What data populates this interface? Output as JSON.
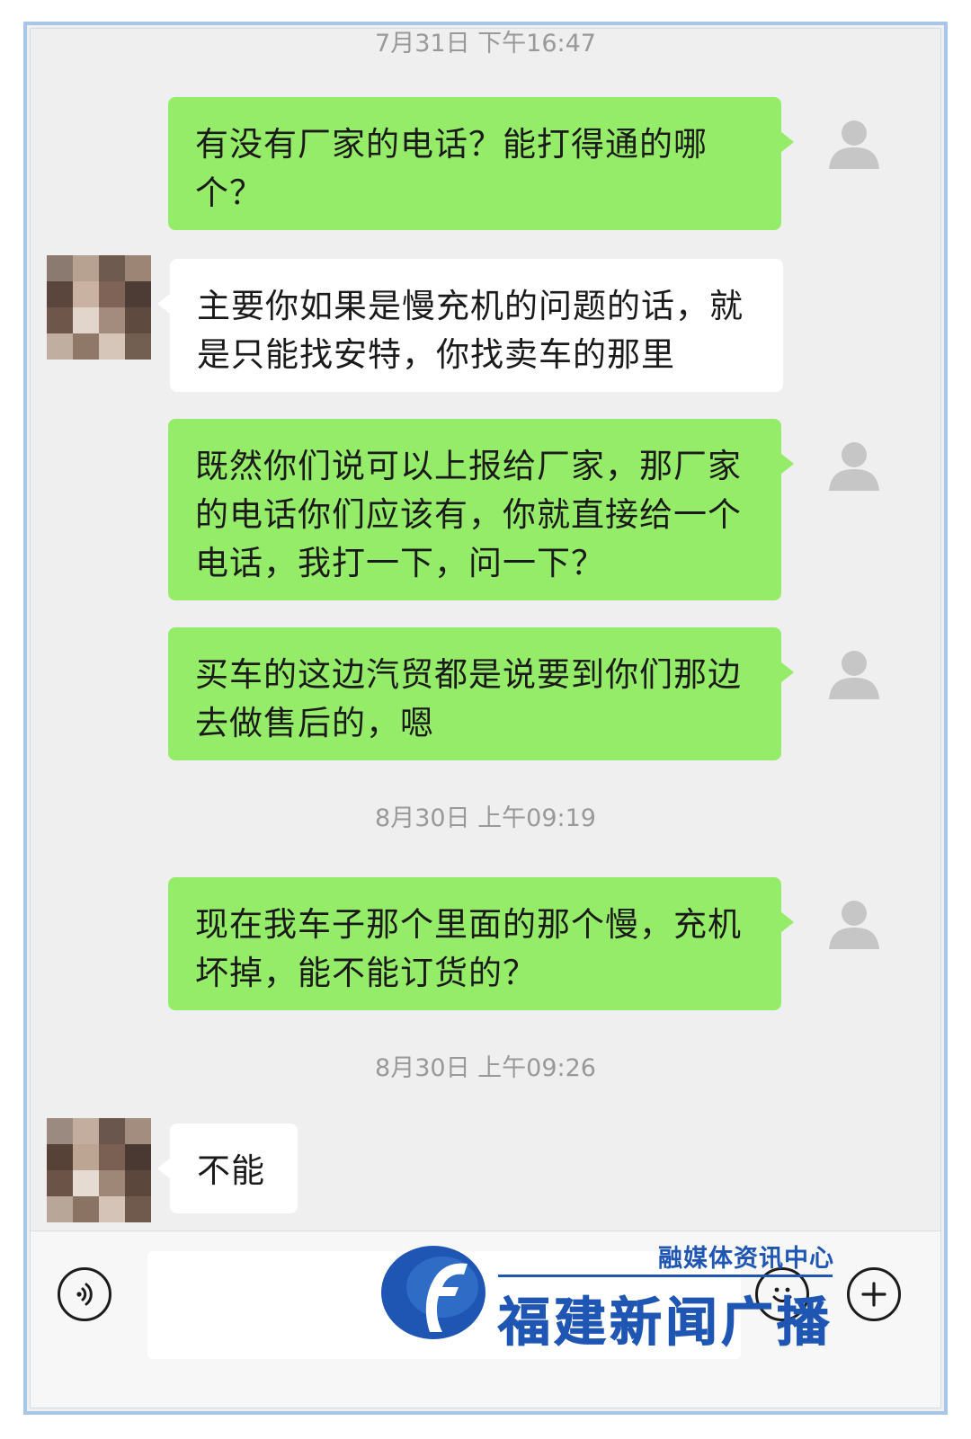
{
  "chat": {
    "timestamps": [
      "7月31日 下午16:47",
      "8月30日 上午09:19",
      "8月30日 上午09:26"
    ],
    "messages": [
      {
        "from": "me",
        "text": "有没有厂家的电话？能打得通的哪个？"
      },
      {
        "from": "other",
        "text": "主要你如果是慢充机的问题的话，就是只能找安特，你找卖车的那里"
      },
      {
        "from": "me",
        "text": "既然你们说可以上报给厂家，那厂家的电话你们应该有，你就直接给一个电话，我打一下，问一下？"
      },
      {
        "from": "me",
        "text": "买车的这边汽贸都是说要到你们那边去做售后的，嗯"
      },
      {
        "from": "me",
        "text": "现在我车子那个里面的那个慢，充机坏掉，能不能订货的？"
      },
      {
        "from": "other",
        "text": "不能"
      }
    ]
  },
  "input_bar": {
    "voice_icon": "voice-icon",
    "emoji_icon": "emoji-icon",
    "plus_icon": "plus-icon"
  },
  "watermark": {
    "sub": "融媒体资讯中心",
    "main": "福建新闻广播"
  },
  "colors": {
    "my_bubble": "#95ec69",
    "other_bubble": "#ffffff",
    "background": "#efefef",
    "frame_border": "#a9c6e8",
    "watermark": "#1f56b3"
  }
}
